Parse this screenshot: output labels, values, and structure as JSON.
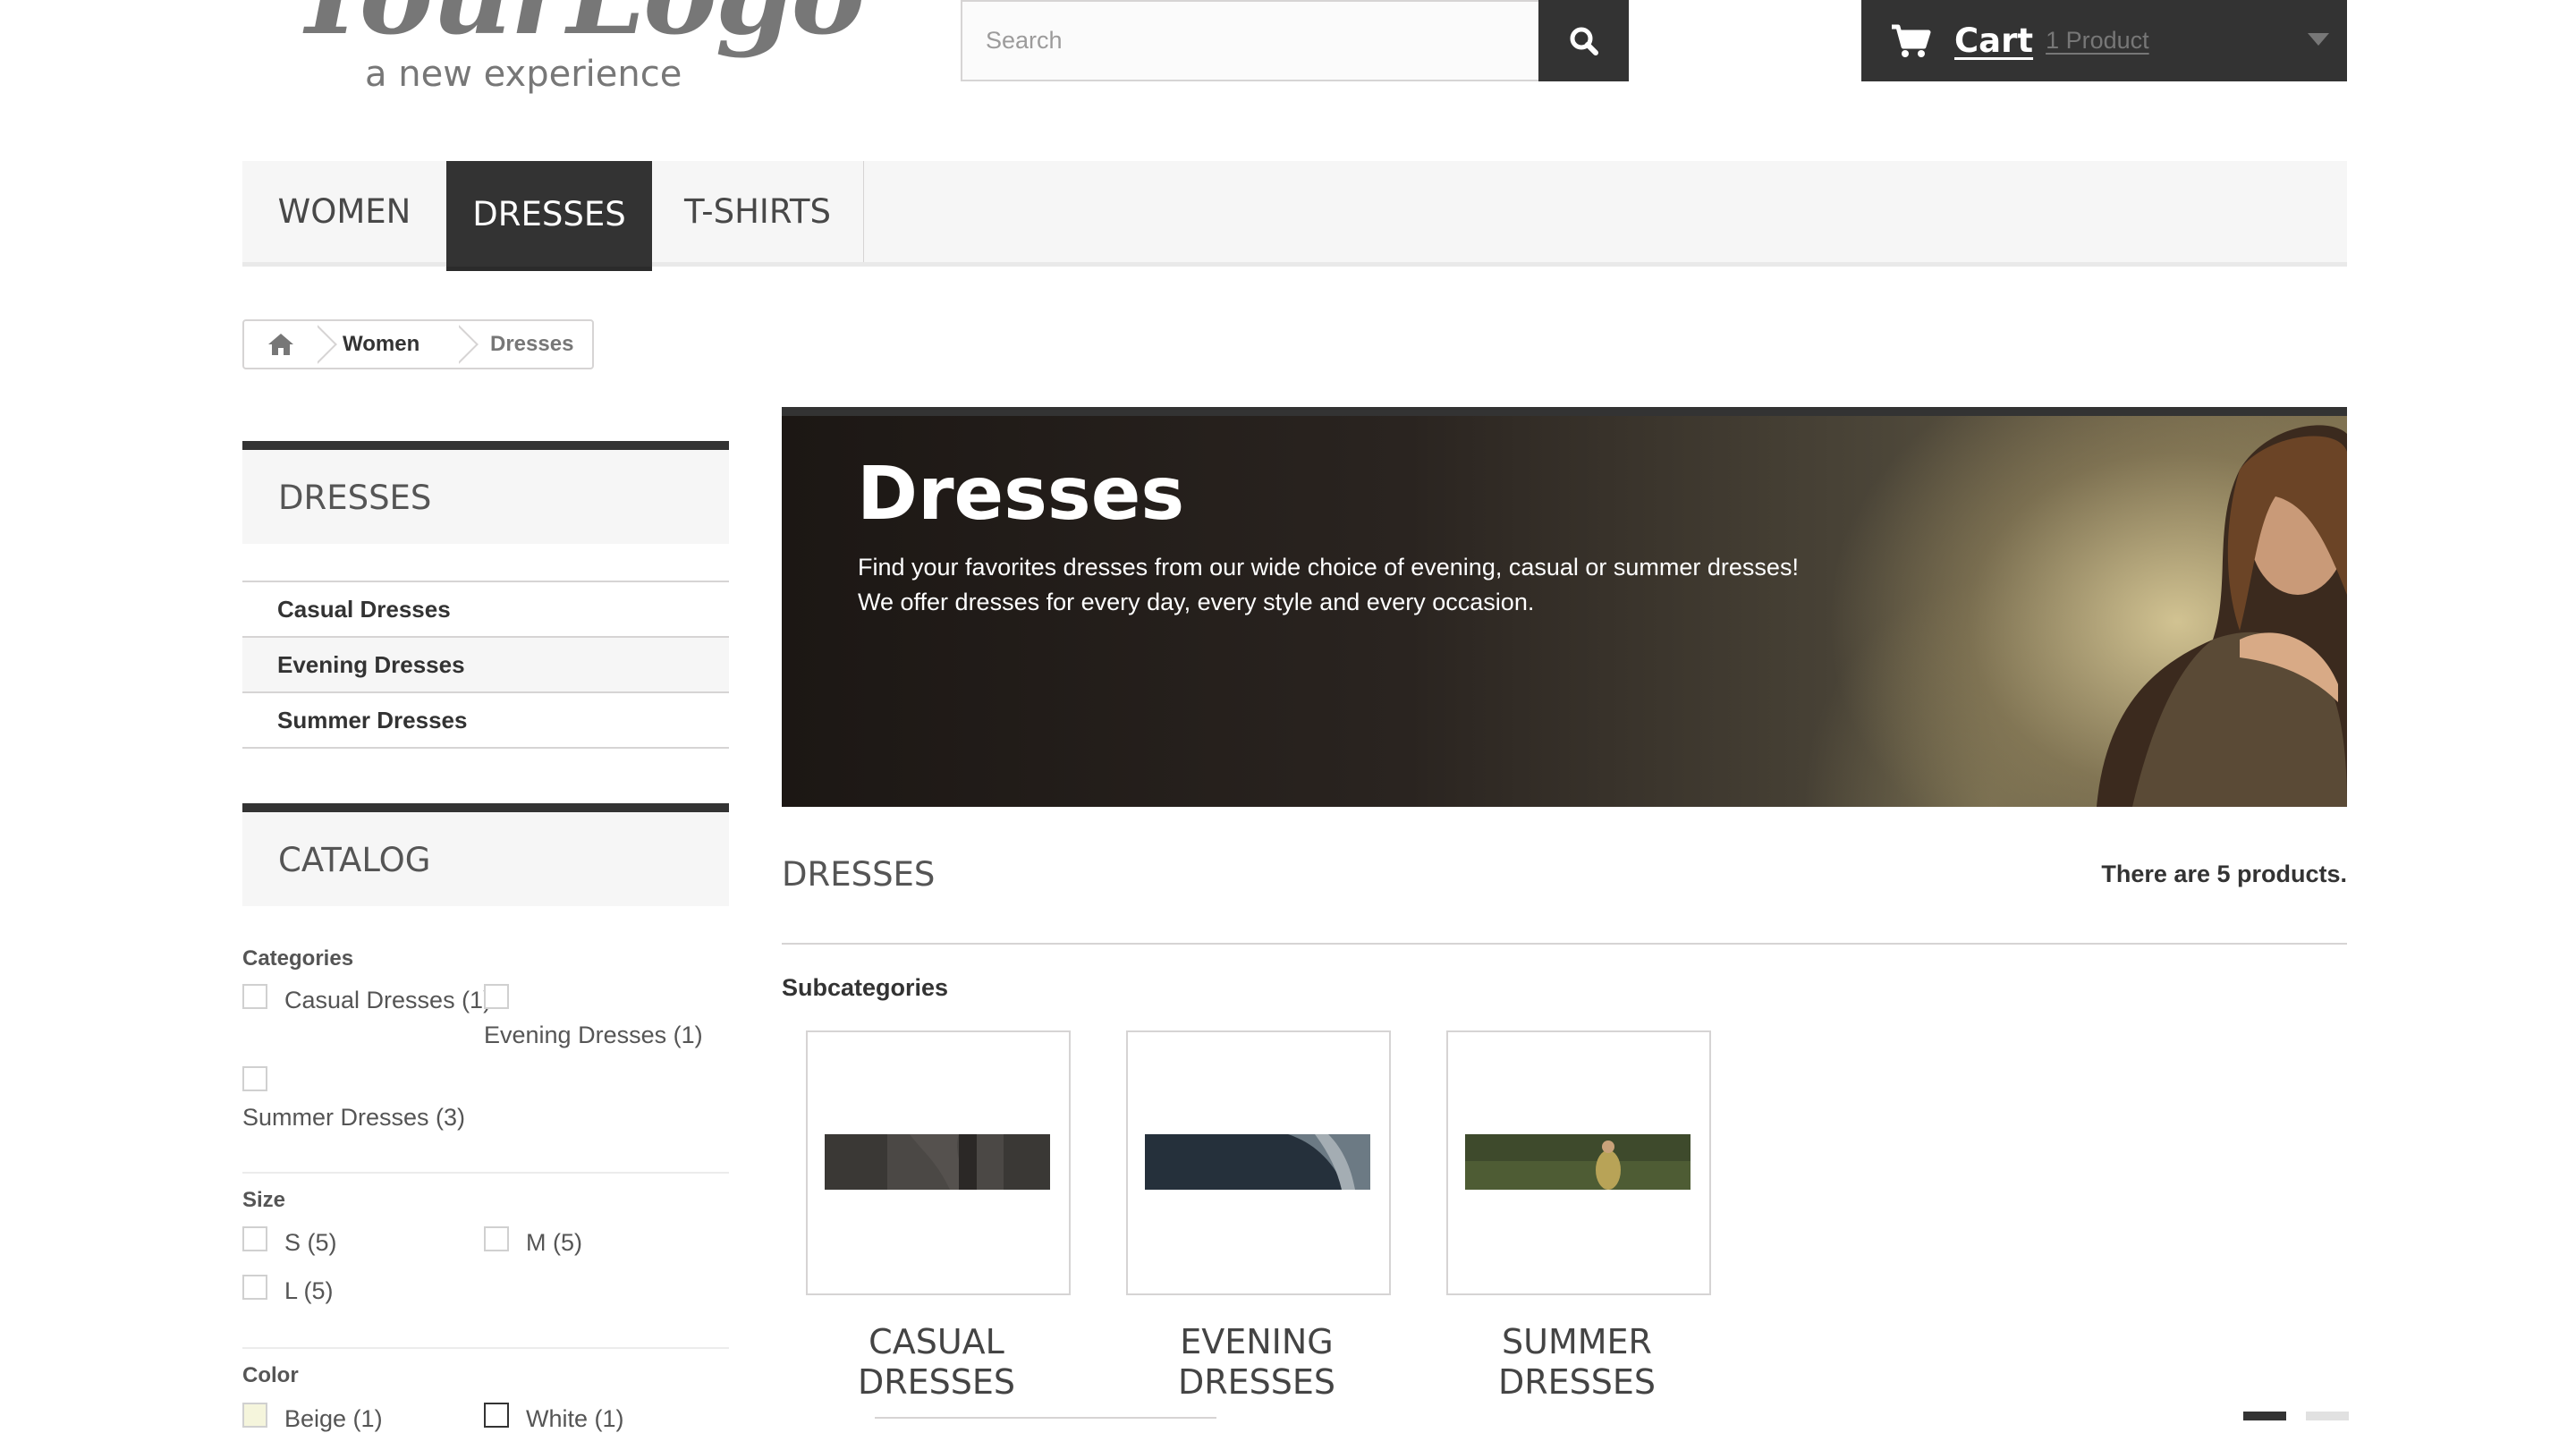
{
  "header": {
    "logo": {
      "script_text": "YourLogo",
      "tagline": "a new experience"
    },
    "search": {
      "placeholder": "Search",
      "value": ""
    },
    "cart": {
      "label": "Cart",
      "quantity_text": "1 Product"
    }
  },
  "menu": {
    "items": [
      {
        "label": "WOMEN",
        "active": false
      },
      {
        "label": "DRESSES",
        "active": true
      },
      {
        "label": "T-SHIRTS",
        "active": false
      }
    ]
  },
  "breadcrumb": {
    "items": [
      "Women",
      "Dresses"
    ]
  },
  "sidebar": {
    "category_block": {
      "title": "DRESSES",
      "items": [
        "Casual Dresses",
        "Evening Dresses",
        "Summer Dresses"
      ]
    },
    "catalog": {
      "title": "CATALOG",
      "categories": {
        "title": "Categories",
        "options": [
          "Casual Dresses (1)",
          "Evening Dresses (1)",
          "Summer Dresses (3)"
        ]
      },
      "size": {
        "title": "Size",
        "options": [
          "S (5)",
          "M (5)",
          "L (5)"
        ]
      },
      "color": {
        "title": "Color",
        "options": [
          "Beige (1)",
          "White (1)"
        ]
      }
    }
  },
  "banner": {
    "title": "Dresses",
    "description": [
      "Find your favorites dresses from our wide choice of evening, casual or summer dresses!",
      "We offer dresses for every day, every style and every occasion."
    ]
  },
  "content": {
    "heading": "DRESSES",
    "product_count": "There are 5 products.",
    "subcategories_title": "Subcategories",
    "subcategories": [
      {
        "name_line1": "CASUAL",
        "name_line2": "DRESSES"
      },
      {
        "name_line1": "EVENING",
        "name_line2": "DRESSES"
      },
      {
        "name_line1": "SUMMER",
        "name_line2": "DRESSES"
      }
    ]
  },
  "colors": {
    "dark": "#333333",
    "panel": "#f6f6f6",
    "border": "#d6d4d4",
    "beige_swatch": "#f5f5dc",
    "white_swatch": "#ffffff"
  },
  "icons": [
    "search-icon",
    "cart-icon",
    "chevron-down-icon",
    "home-icon",
    "grid-view-icon",
    "list-view-icon"
  ]
}
